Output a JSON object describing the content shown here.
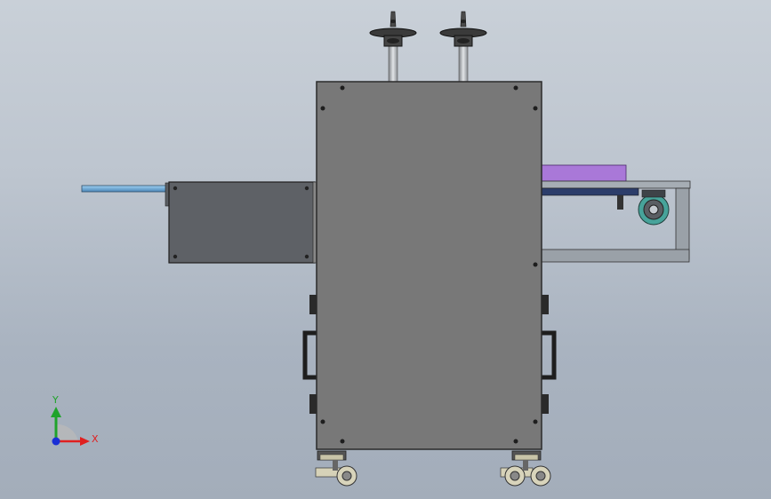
{
  "triad": {
    "y_label": "Y",
    "x_label": "X",
    "y_color": "#1fa32a",
    "x_color": "#e02020",
    "z_color": "#1a2fd6"
  },
  "colors": {
    "cabinet_fill": "#787878",
    "cabinet_edge": "#2a2a2a",
    "side_box_fill": "#5e6166",
    "pipe_fill": "#6aa6d6",
    "purple_block": "#a978d8",
    "frame_fill": "#9aa1a8"
  }
}
